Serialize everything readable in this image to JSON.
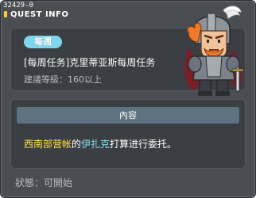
{
  "window": {
    "quest_id": "32429-0",
    "title": "QUEST INFO"
  },
  "quest": {
    "category": "每週",
    "name": "[每周任务]克里蒂亚斯每周任务",
    "level_label": "建議等級：",
    "level_value": "160以上"
  },
  "content": {
    "header": "內容",
    "text_location": "西南部营帐",
    "text_mid": "的",
    "text_npc": "伊扎克",
    "text_end": "打算进行委托。"
  },
  "status": {
    "label": "狀態：",
    "value": "可開始"
  },
  "colors": {
    "badge": "#7fd6ec",
    "location_highlight": "#ffe14a",
    "npc_highlight": "#7fe0f0",
    "panel": "#3b3e43",
    "window": "#4a4d52"
  }
}
